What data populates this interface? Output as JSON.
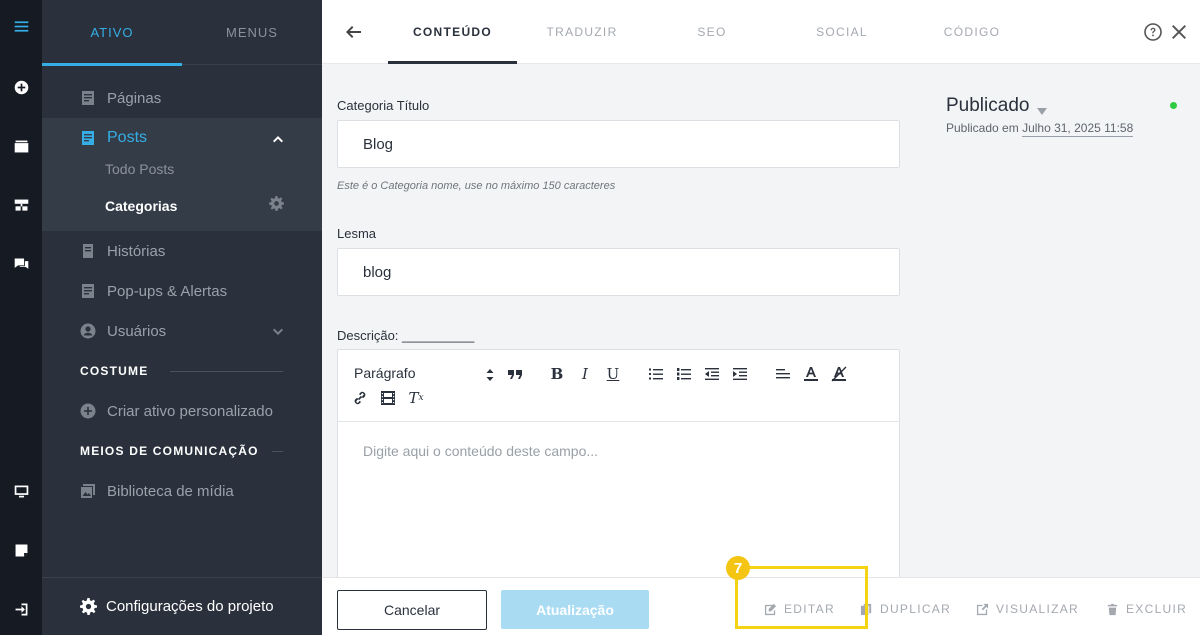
{
  "sidebar": {
    "tabs": [
      {
        "label": "ATIVO"
      },
      {
        "label": "MENUS"
      }
    ],
    "items": {
      "paginas": "Páginas",
      "posts": "Posts",
      "todo_posts": "Todo Posts",
      "categorias": "Categorias",
      "historias": "Histórias",
      "popups": "Pop-ups & Alertas",
      "usuarios": "Usuários",
      "criar_ativo": "Criar ativo personalizado",
      "biblioteca": "Biblioteca de mídia"
    },
    "sections": {
      "costume": "COSTUME",
      "meios": "MEIOS DE COMUNICAÇÃO"
    },
    "bottom": "Configurações do projeto"
  },
  "topbar": {
    "tabs": [
      {
        "label": "CONTEÚDO"
      },
      {
        "label": "TRADUZIR"
      },
      {
        "label": "SEO"
      },
      {
        "label": "SOCIAL"
      },
      {
        "label": "CÓDIGO"
      }
    ]
  },
  "form": {
    "title_label": "Categoria Título",
    "title_value": "Blog",
    "title_hint": "Este é o Categoria nome, use no máximo 150 caracteres",
    "slug_label": "Lesma",
    "slug_value": "blog",
    "desc_label": "Descrição: __________",
    "format": "Parágrafo",
    "placeholder": "Digite aqui o conteúdo deste campo..."
  },
  "status": {
    "title": "Publicado",
    "prefix": "Publicado em",
    "date": "Julho 31, 2025 11:58"
  },
  "footer": {
    "cancel": "Cancelar",
    "update": "Atualização",
    "editar": "EDITAR",
    "duplicar": "DUPLICAR",
    "visualizar": "VISUALIZAR",
    "excluir": "EXCLUIR"
  },
  "annotation": {
    "badge": "7"
  },
  "colors": {
    "accent": "#35aee6",
    "highlight": "#f4d313",
    "status": "#2ecc40"
  }
}
